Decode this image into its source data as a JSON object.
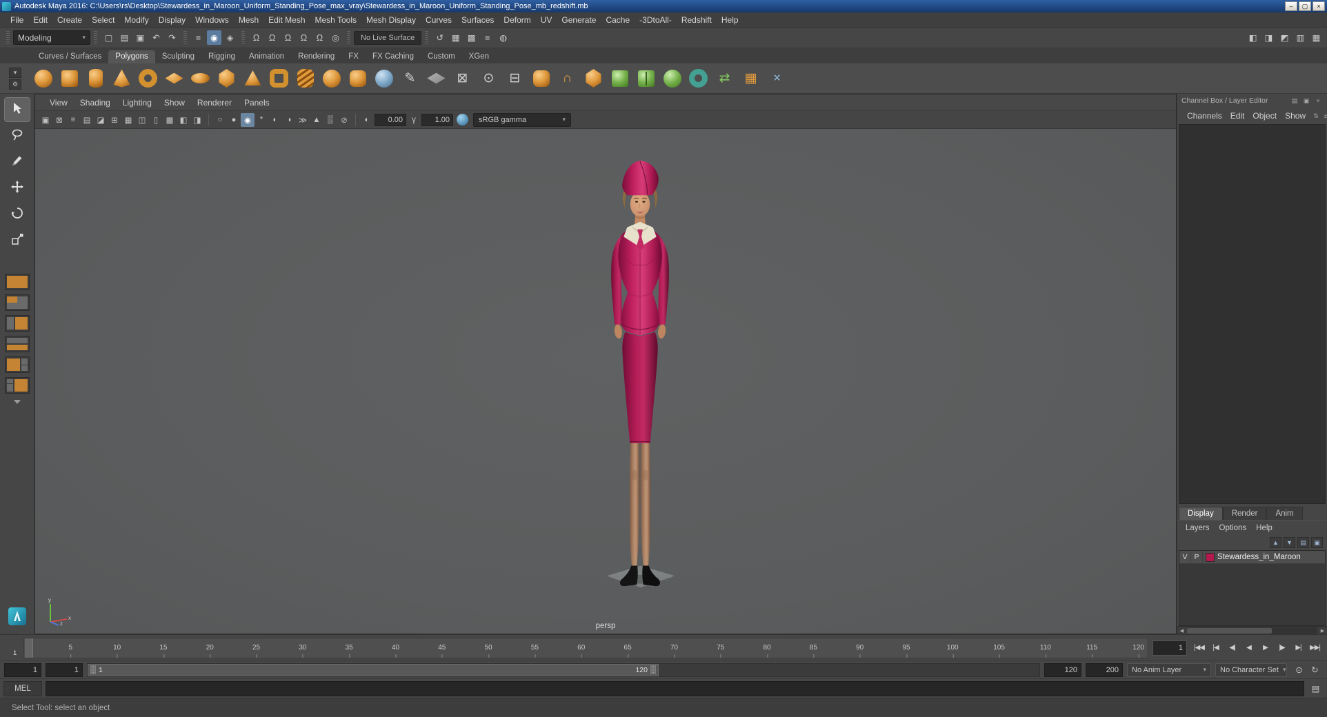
{
  "window": {
    "title": "Autodesk Maya 2016: C:\\Users\\rs\\Desktop\\Stewardess_in_Maroon_Uniform_Standing_Pose_max_vray\\Stewardess_in_Maroon_Uniform_Standing_Pose_mb_redshift.mb",
    "controls": [
      {
        "name": "minimize-button",
        "glyph": "–"
      },
      {
        "name": "maximize-button",
        "glyph": "▢"
      },
      {
        "name": "close-button",
        "glyph": "×"
      }
    ]
  },
  "menu_bar": [
    "File",
    "Edit",
    "Create",
    "Select",
    "Modify",
    "Display",
    "Windows",
    "Mesh",
    "Edit Mesh",
    "Mesh Tools",
    "Mesh Display",
    "Curves",
    "Surfaces",
    "Deform",
    "UV",
    "Generate",
    "Cache",
    "-3DtoAll-",
    "Redshift",
    "Help"
  ],
  "status_line": {
    "mode": "Modeling",
    "live_surface": "No Live Surface",
    "file_icons": [
      {
        "name": "new-scene-icon",
        "glyph": "▢"
      },
      {
        "name": "open-scene-icon",
        "glyph": "▤"
      },
      {
        "name": "save-scene-icon",
        "glyph": "▣"
      },
      {
        "name": "undo-icon",
        "glyph": "↶"
      },
      {
        "name": "redo-icon",
        "glyph": "↷"
      }
    ],
    "selection_icons": [
      {
        "name": "select-hierarchy-icon",
        "glyph": "≡",
        "cls": ""
      },
      {
        "name": "select-object-icon",
        "glyph": "◉",
        "cls": "active"
      },
      {
        "name": "select-component-icon",
        "glyph": "◈",
        "cls": ""
      }
    ],
    "snap_icons": [
      {
        "name": "snap-to-grid-icon",
        "glyph": "Ω"
      },
      {
        "name": "snap-to-curve-icon",
        "glyph": "Ω"
      },
      {
        "name": "snap-to-point-icon",
        "glyph": "Ω"
      },
      {
        "name": "snap-to-plane-icon",
        "glyph": "Ω"
      },
      {
        "name": "snap-to-view-plane-icon",
        "glyph": "Ω"
      },
      {
        "name": "make-live-icon",
        "glyph": "◎"
      }
    ],
    "render_icons": [
      {
        "name": "construction-history-icon",
        "glyph": "↺"
      },
      {
        "name": "render-current-frame-icon",
        "glyph": "▦"
      },
      {
        "name": "ipr-render-icon",
        "glyph": "▩"
      },
      {
        "name": "render-settings-icon",
        "glyph": "≡"
      },
      {
        "name": "display-settings-icon",
        "glyph": "◍"
      }
    ],
    "right_icons": [
      {
        "name": "panel-layout-icon",
        "glyph": "◧"
      },
      {
        "name": "attribute-editor-toggle-icon",
        "glyph": "◨"
      },
      {
        "name": "tool-settings-toggle-icon",
        "glyph": "◩"
      },
      {
        "name": "channel-box-toggle-icon",
        "glyph": "▥"
      },
      {
        "name": "outliner-toggle-icon",
        "glyph": "▦"
      }
    ]
  },
  "shelf": {
    "menu_icons": [
      {
        "name": "shelf-tabs-toggle-icon",
        "glyph": "▾"
      },
      {
        "name": "shelf-menu-gear-icon",
        "glyph": "⚙"
      }
    ],
    "tabs": [
      {
        "label": "Curves / Surfaces",
        "state": ""
      },
      {
        "label": "Polygons",
        "state": "active"
      },
      {
        "label": "Sculpting",
        "state": ""
      },
      {
        "label": "Rigging",
        "state": ""
      },
      {
        "label": "Animation",
        "state": ""
      },
      {
        "label": "Rendering",
        "state": ""
      },
      {
        "label": "FX",
        "state": ""
      },
      {
        "label": "FX Caching",
        "state": ""
      },
      {
        "label": "Custom",
        "state": ""
      },
      {
        "label": "XGen",
        "state": ""
      }
    ],
    "icons": [
      {
        "name": "poly-sphere-icon",
        "cls": "c-or sphere"
      },
      {
        "name": "poly-cube-icon",
        "cls": "c-or cube"
      },
      {
        "name": "poly-cylinder-icon",
        "cls": "c-or cylinder"
      },
      {
        "name": "poly-cone-icon",
        "cls": "c-or cone"
      },
      {
        "name": "poly-torus-icon",
        "cls": "ring-or"
      },
      {
        "name": "poly-plane-icon",
        "cls": "c-or plane"
      },
      {
        "name": "poly-disc-icon",
        "cls": "c-or disc"
      },
      {
        "name": "poly-platonic-icon",
        "cls": "c-or gem"
      },
      {
        "name": "poly-pyramid-icon",
        "cls": "c-or pyramid"
      },
      {
        "name": "poly-pipe-icon",
        "cls": "ring-or square"
      },
      {
        "name": "poly-helix-icon",
        "cls": "c-or helix"
      },
      {
        "name": "poly-soccer-ball-icon",
        "cls": "c-or sphere"
      },
      {
        "name": "poly-superellipse-icon",
        "cls": "c-or cube rounded"
      },
      {
        "name": "sculpt-tool-icon",
        "cls": "c-bl sphere"
      },
      {
        "name": "quad-draw-icon",
        "glyph": "✎",
        "cls": "glyph-gray"
      },
      {
        "name": "create-polygon-icon",
        "cls": "c-gy plane"
      },
      {
        "name": "multi-cut-icon",
        "glyph": "⊠",
        "cls": "glyph-gray"
      },
      {
        "name": "target-weld-icon",
        "glyph": "⊙",
        "cls": "glyph-gray"
      },
      {
        "name": "insert-edge-loop-icon",
        "glyph": "⊟",
        "cls": "glyph-gray"
      },
      {
        "name": "bevel-icon",
        "cls": "c-or cube rounded"
      },
      {
        "name": "bridge-icon",
        "glyph": "∩",
        "cls": "glyph-or"
      },
      {
        "name": "extrude-icon",
        "cls": "c-or gem"
      },
      {
        "name": "combine-icon",
        "cls": "c-gr cube"
      },
      {
        "name": "separate-icon",
        "cls": "c-gr cube split"
      },
      {
        "name": "boolean-union-icon",
        "cls": "c-gr sphere"
      },
      {
        "name": "smooth-icon",
        "cls": "ring-tl"
      },
      {
        "name": "mirror-icon",
        "glyph": "⇄",
        "cls": "glyph-gr"
      },
      {
        "name": "uv-checker-icon",
        "glyph": "▦",
        "cls": "glyph-or"
      },
      {
        "name": "cleanup-icon",
        "glyph": "×",
        "cls": "glyph-bl"
      }
    ]
  },
  "panel_menu": [
    "View",
    "Shading",
    "Lighting",
    "Show",
    "Renderer",
    "Panels"
  ],
  "viewport": {
    "left_icons": [
      {
        "name": "select-camera-icon",
        "glyph": "▣"
      },
      {
        "name": "lock-camera-icon",
        "glyph": "⊠"
      },
      {
        "name": "camera-attributes-icon",
        "glyph": "≡"
      },
      {
        "name": "bookmarks-icon",
        "glyph": "▤"
      },
      {
        "name": "image-plane-icon",
        "glyph": "◪"
      },
      {
        "name": "2d-pan-zoom-icon",
        "glyph": "⊞"
      },
      {
        "name": "grid-toggle-icon",
        "glyph": "▦"
      },
      {
        "name": "film-gate-icon",
        "glyph": "◫"
      },
      {
        "name": "resolution-gate-icon",
        "glyph": "▯"
      },
      {
        "name": "gate-mask-icon",
        "glyph": "▩"
      },
      {
        "name": "field-chart-icon",
        "glyph": "◧"
      },
      {
        "name": "safe-action-icon",
        "glyph": "◨"
      }
    ],
    "display_icons": [
      {
        "name": "wireframe-mode-icon",
        "glyph": "○",
        "cls": ""
      },
      {
        "name": "shaded-mode-icon",
        "glyph": "●",
        "cls": ""
      },
      {
        "name": "textured-mode-icon",
        "glyph": "◉",
        "cls": "active"
      },
      {
        "name": "use-all-lights-icon",
        "glyph": "*",
        "cls": ""
      },
      {
        "name": "shadows-icon",
        "glyph": "◐",
        "cls": ""
      },
      {
        "name": "screen-space-ao-icon",
        "glyph": "◑",
        "cls": ""
      },
      {
        "name": "motion-blur-icon",
        "glyph": "≫",
        "cls": ""
      },
      {
        "name": "multisample-aa-icon",
        "glyph": "▲",
        "cls": ""
      },
      {
        "name": "xray-icon",
        "glyph": "▒",
        "cls": ""
      },
      {
        "name": "isolate-select-icon",
        "glyph": "⊘",
        "cls": ""
      }
    ],
    "exposure_icon": "◐",
    "gamma_icon": "γ",
    "exposure": "0.00",
    "gamma": "1.00",
    "color_mode": "sRGB gamma",
    "camera_label": "persp"
  },
  "toolbox": {
    "tools": [
      "select-tool",
      "lasso-tool",
      "paint-selection-tool",
      "move-tool",
      "rotate-tool",
      "scale-tool"
    ]
  },
  "channel_box": {
    "header": "Channel Box / Layer Editor",
    "header_icons": [
      {
        "name": "panel-options-icon",
        "glyph": "▤"
      },
      {
        "name": "panel-dock-icon",
        "glyph": "▣"
      },
      {
        "name": "panel-close-icon",
        "glyph": "×"
      }
    ],
    "menus": [
      "Channels",
      "Edit",
      "Object",
      "Show"
    ],
    "menu_icons": [
      {
        "name": "channel-slider-speed-icon",
        "glyph": "⇅"
      },
      {
        "name": "channel-manipulator-icon",
        "glyph": "±"
      }
    ],
    "layer_editor": {
      "tabs": [
        {
          "label": "Display",
          "state": "active"
        },
        {
          "label": "Render",
          "state": ""
        },
        {
          "label": "Anim",
          "state": ""
        }
      ],
      "menus": [
        "Layers",
        "Options",
        "Help"
      ],
      "icons": [
        {
          "name": "move-layer-up-icon",
          "glyph": "▲"
        },
        {
          "name": "move-layer-down-icon",
          "glyph": "▼"
        },
        {
          "name": "create-empty-layer-icon",
          "glyph": "▤"
        },
        {
          "name": "create-layer-from-selected-icon",
          "glyph": "▣"
        }
      ],
      "layer": {
        "visible": "V",
        "playback": "P",
        "color": "#b3194d",
        "name": "Stewardess_in_Maroon"
      },
      "scrollbar": {
        "left": "◀",
        "right": "▶"
      }
    }
  },
  "timeline": {
    "ticks": [
      5,
      10,
      15,
      20,
      25,
      30,
      35,
      40,
      45,
      50,
      55,
      60,
      65,
      70,
      75,
      80,
      85,
      90,
      95,
      100,
      105,
      110,
      115,
      120
    ],
    "range_max_for_layout": 121,
    "current_frame": "1",
    "current_frame_field": "1",
    "transport": [
      {
        "name": "go-to-start-button",
        "glyph": "|◀◀"
      },
      {
        "name": "step-back-frame-button",
        "glyph": "|◀"
      },
      {
        "name": "step-back-key-button",
        "glyph": "◀|"
      },
      {
        "name": "play-backwards-button",
        "glyph": "◀"
      },
      {
        "name": "play-forwards-button",
        "glyph": "▶"
      },
      {
        "name": "step-forward-key-button",
        "glyph": "|▶"
      },
      {
        "name": "step-forward-frame-button",
        "glyph": "▶|"
      },
      {
        "name": "go-to-end-button",
        "glyph": "▶▶|"
      }
    ]
  },
  "range_slider": {
    "anim_start": "1",
    "playback_start": "1",
    "playback_end": "120",
    "anim_end": "200",
    "anim_layer": "No Anim Layer",
    "character_set": "No Character Set",
    "icons": [
      {
        "name": "auto-keyframe-icon",
        "glyph": "⊙"
      },
      {
        "name": "animation-preferences-icon",
        "glyph": "↻"
      }
    ]
  },
  "command_line": {
    "label": "MEL",
    "script_editor_glyph": "▤"
  },
  "help_line": {
    "text": "Select Tool: select an object"
  }
}
